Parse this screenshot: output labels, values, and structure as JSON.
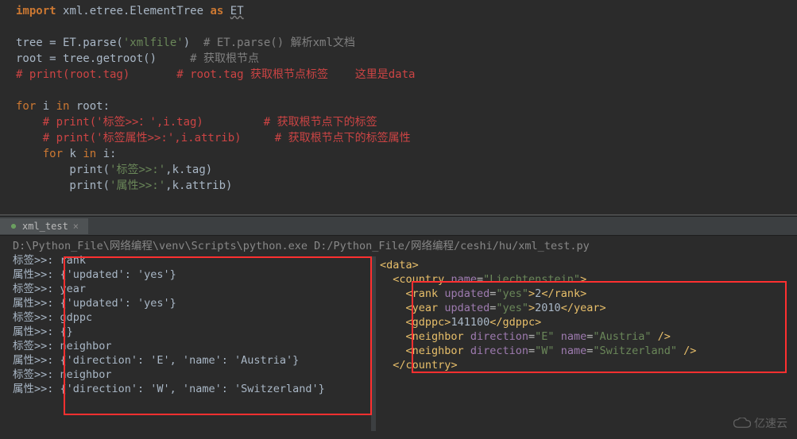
{
  "editor": {
    "l1_import": "import",
    "l1_mod": "xml.etree.ElementTree",
    "l1_as": "as",
    "l1_alias": "ET",
    "l3a": "tree = ET.parse(",
    "l3s": "'xmlfile'",
    "l3b": ")  ",
    "l3c": "# ET.parse() 解析xml文档",
    "l4a": "root = tree.getroot()     ",
    "l4c": "# 获取根节点",
    "l5": "# print(root.tag)       # root.tag 获取根节点标签    这里是data",
    "l7for": "for",
    "l7a": " i ",
    "l7in": "in",
    "l7b": " root:",
    "l8": "    # print('标签>>：',i.tag)         # 获取根节点下的标签",
    "l9": "    # print('标签属性>>:',i.attrib)     # 获取根节点下的标签属性",
    "l10for": "    for",
    "l10a": " k ",
    "l10in": "in",
    "l10b": " i:",
    "l11a": "        print(",
    "l11s": "'标签>>:'",
    "l11b": ",k.tag)",
    "l12a": "        print(",
    "l12s": "'属性>>:'",
    "l12b": ",k.attrib)"
  },
  "tab_name": "xml_test",
  "console": {
    "path": "D:\\Python_File\\网络编程\\venv\\Scripts\\python.exe D:/Python_File/网络编程/ceshi/hu/xml_test.py",
    "lines": [
      "标签>>: rank",
      "属性>>: {'updated': 'yes'}",
      "标签>>: year",
      "属性>>: {'updated': 'yes'}",
      "标签>>: gdppc",
      "属性>>: {}",
      "标签>>: neighbor",
      "属性>>: {'direction': 'E', 'name': 'Austria'}",
      "标签>>: neighbor",
      "属性>>: {'direction': 'W', 'name': 'Switzerland'}"
    ]
  },
  "xml": {
    "root": "data",
    "country_name": "Liechtenstein",
    "rank_updated": "yes",
    "rank_val": "2",
    "year_updated": "yes",
    "year_val": "2010",
    "gdppc_val": "141100",
    "n1_dir": "E",
    "n1_name": "Austria",
    "n2_dir": "W",
    "n2_name": "Switzerland"
  },
  "watermark": "亿速云"
}
